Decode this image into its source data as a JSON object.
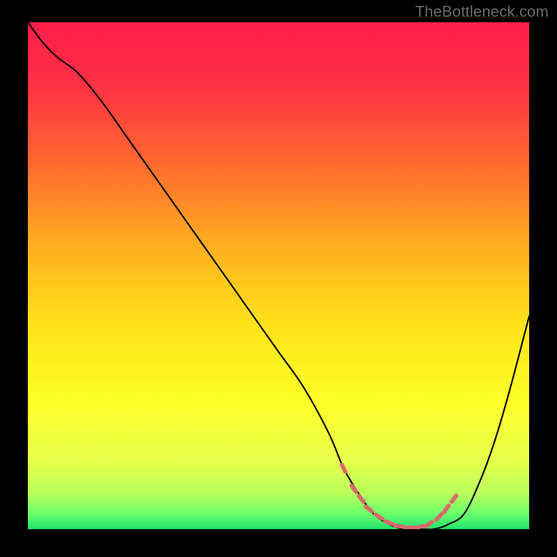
{
  "attribution": "TheBottleneck.com",
  "chart_data": {
    "type": "line",
    "title": "",
    "xlabel": "",
    "ylabel": "",
    "xlim": [
      0,
      100
    ],
    "ylim": [
      0,
      100
    ],
    "gradient_stops": [
      {
        "offset": 0,
        "color": "#ff1e4a"
      },
      {
        "offset": 12,
        "color": "#ff2f44"
      },
      {
        "offset": 28,
        "color": "#ff6a2f"
      },
      {
        "offset": 45,
        "color": "#ffb21f"
      },
      {
        "offset": 60,
        "color": "#ffe31a"
      },
      {
        "offset": 75,
        "color": "#fdff28"
      },
      {
        "offset": 86,
        "color": "#e8ff4a"
      },
      {
        "offset": 93,
        "color": "#baff5c"
      },
      {
        "offset": 97,
        "color": "#6bff6b"
      },
      {
        "offset": 100,
        "color": "#21e36f"
      }
    ],
    "series": [
      {
        "name": "bottleneck-curve",
        "x": [
          0,
          3,
          6,
          10,
          15,
          20,
          25,
          30,
          35,
          40,
          45,
          50,
          55,
          60,
          63,
          66,
          69,
          72,
          75,
          78,
          81,
          84,
          87,
          90,
          93,
          96,
          100
        ],
        "y": [
          100,
          96,
          93,
          90,
          84,
          77,
          70,
          63,
          56,
          49,
          42,
          35,
          28,
          19,
          12,
          7,
          3,
          1,
          0,
          0,
          0,
          1,
          3,
          9,
          17,
          27,
          42
        ]
      }
    ],
    "markers": {
      "name": "optimal-range",
      "color": "#d96a6a",
      "points_xy": [
        [
          63,
          12
        ],
        [
          65,
          8
        ],
        [
          66.5,
          6
        ],
        [
          68,
          4
        ],
        [
          70,
          2.5
        ],
        [
          72,
          1.3
        ],
        [
          74,
          0.6
        ],
        [
          76,
          0.3
        ],
        [
          78,
          0.4
        ],
        [
          80,
          1.0
        ],
        [
          82,
          2.4
        ],
        [
          83.5,
          4.0
        ],
        [
          85,
          6.0
        ]
      ]
    }
  }
}
